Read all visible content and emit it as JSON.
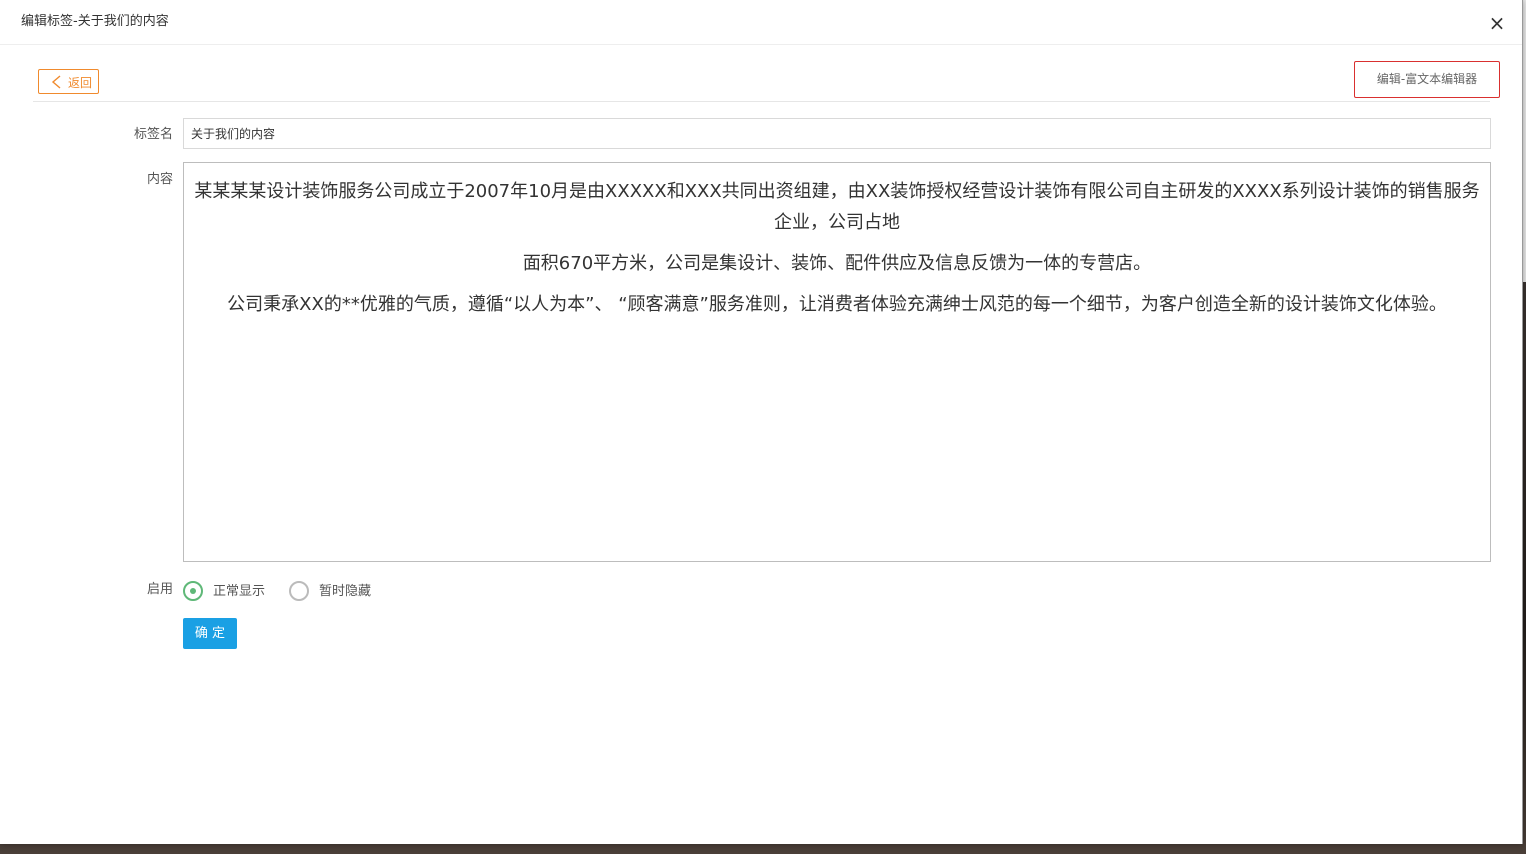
{
  "window": {
    "title": "编辑标签-关于我们的内容",
    "close_glyph": "×"
  },
  "toolbar": {
    "back_label": "返回",
    "back_icon": "chevron-left-icon",
    "rich_text_label": "编辑-富文本编辑器",
    "accent_color": "#f08a2d",
    "highlight_color": "#d9302f"
  },
  "form": {
    "tag_name_label": "标签名",
    "tag_name_value": "关于我们的内容",
    "content_label": "内容",
    "content_paragraphs": [
      "某某某某设计装饰服务公司成立于2007年10月是由XXXXX和XXX共同出资组建，由XX装饰授权经营设计装饰有限公司自主研发的XXXX系列设计装饰的销售服务企业，公司占地",
      "面积670平方米，公司是集设计、装饰、配件供应及信息反馈为一体的专营店。",
      "公司秉承XX的**优雅的气质，遵循“以人为本”、 “顾客满意”服务准则，让消费者体验充满绅士风范的每一个细节，为客户创造全新的设计装饰文化体验。"
    ],
    "enable_label": "启用",
    "enable_options": [
      {
        "label": "正常显示",
        "checked": true
      },
      {
        "label": "暂时隐藏",
        "checked": false
      }
    ],
    "submit_label": "确 定",
    "submit_color": "#1aa0e4",
    "radio_checked_color": "#5fb878"
  }
}
